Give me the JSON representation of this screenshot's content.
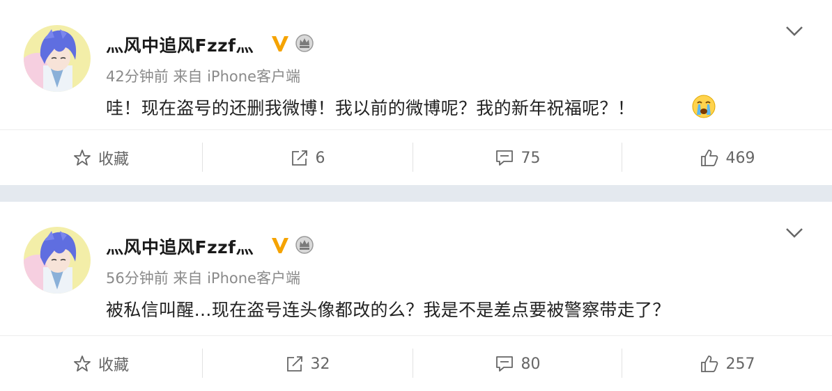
{
  "colors": {
    "page_bg": "#e4e9ef",
    "card_bg": "#ffffff",
    "verified": "#f5a300",
    "text_muted": "#8a8a8a"
  },
  "posts": [
    {
      "username": "灬风中追风Fzzf灬",
      "time": "42分钟前",
      "source": "来自 iPhone客户端",
      "content": "哇！现在盗号的还删我微博！我以前的微博呢？我的新年祝福呢？！",
      "emoji": "cry-emoji",
      "actions": {
        "favorite": "收藏",
        "repost": "6",
        "comment": "75",
        "like": "469"
      }
    },
    {
      "username": "灬风中追风Fzzf灬",
      "time": "56分钟前",
      "source": "来自 iPhone客户端",
      "content": "被私信叫醒…现在盗号连头像都改的么？我是不是差点要被警察带走了？",
      "actions": {
        "favorite": "收藏",
        "repost": "32",
        "comment": "80",
        "like": "257"
      }
    }
  ]
}
